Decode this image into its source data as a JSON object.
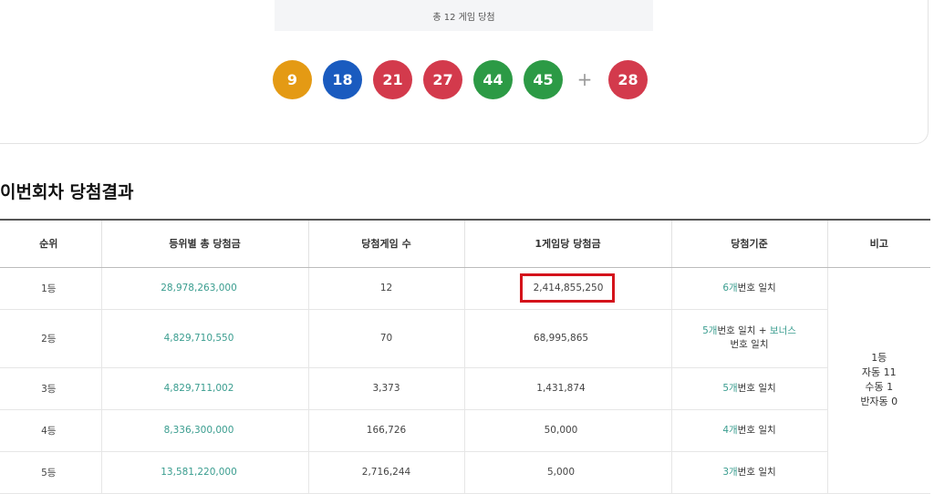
{
  "summary_text": "총 12 게임 당첨",
  "balls": [
    {
      "n": "9",
      "color": "#e49a14"
    },
    {
      "n": "18",
      "color": "#1a5bbf"
    },
    {
      "n": "21",
      "color": "#d33a4c"
    },
    {
      "n": "27",
      "color": "#d33a4c"
    },
    {
      "n": "44",
      "color": "#2c9a45"
    },
    {
      "n": "45",
      "color": "#2c9a45"
    }
  ],
  "plus": "+",
  "bonus_ball": {
    "n": "28",
    "color": "#d33a4c"
  },
  "section_title": "이번회차 당첨결과",
  "table": {
    "headers": [
      "순위",
      "등위별 총 당첨금",
      "당첨게임 수",
      "1게임당 당첨금",
      "당첨기준",
      "비고"
    ],
    "rows": [
      {
        "rank": "1등",
        "total": "28,978,263,000",
        "games": "12",
        "per": "2,414,855,250",
        "crit_hl": "6개",
        "crit_rest": "번호 일치"
      },
      {
        "rank": "2등",
        "total": "4,829,710,550",
        "games": "70",
        "per": "68,995,865",
        "crit_hl": "5개",
        "crit_rest": "번호 일치 + ",
        "crit_hl2": "보너스",
        "crit_rest2": "번호 일치"
      },
      {
        "rank": "3등",
        "total": "4,829,711,002",
        "games": "3,373",
        "per": "1,431,874",
        "crit_hl": "5개",
        "crit_rest": "번호 일치"
      },
      {
        "rank": "4등",
        "total": "8,336,300,000",
        "games": "166,726",
        "per": "50,000",
        "crit_hl": "4개",
        "crit_rest": "번호 일치"
      },
      {
        "rank": "5등",
        "total": "13,581,220,000",
        "games": "2,716,244",
        "per": "5,000",
        "crit_hl": "3개",
        "crit_rest": "번호 일치"
      }
    ],
    "note": {
      "l1": "1등",
      "l2": "자동 11",
      "l3": "수동 1",
      "l4": "반자동 0"
    }
  },
  "colors": {
    "accent": "#3a9d8f",
    "highlight_border": "#d4131b"
  }
}
